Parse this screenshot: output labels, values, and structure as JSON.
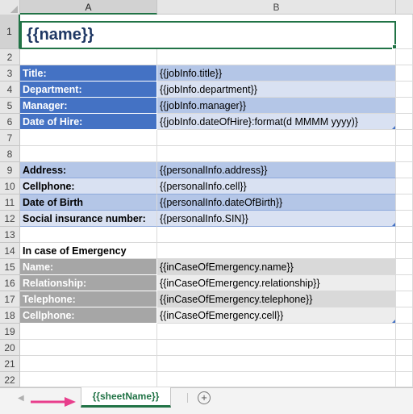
{
  "columns": [
    "A",
    "B"
  ],
  "rows": [
    "1",
    "2",
    "3",
    "4",
    "5",
    "6",
    "7",
    "8",
    "9",
    "10",
    "11",
    "12",
    "13",
    "14",
    "15",
    "16",
    "17",
    "18",
    "19",
    "20",
    "21",
    "22"
  ],
  "title": "{{name}}",
  "job_section": [
    {
      "label": "Title:",
      "value": "{{jobInfo.title}}"
    },
    {
      "label": "Department:",
      "value": "{{jobInfo.department}}"
    },
    {
      "label": "Manager:",
      "value": "{{jobInfo.manager}}"
    },
    {
      "label": "Date of Hire:",
      "value": "{{jobInfo.dateOfHire}:format(d MMMM yyyy)}"
    }
  ],
  "personal_section": [
    {
      "label": "Address:",
      "value": "{{personalInfo.address}}"
    },
    {
      "label": "Cellphone:",
      "value": "{{personalInfo.cell}}"
    },
    {
      "label": "Date of Birth",
      "value": "{{personalInfo.dateOfBirth}}"
    },
    {
      "label": "Social insurance number:",
      "value": "{{personalInfo.SIN}}"
    }
  ],
  "emergency_heading": "In case of Emergency",
  "emergency_section": [
    {
      "label": "Name:",
      "value": "{{inCaseOfEmergency.name}}"
    },
    {
      "label": "Relationship:",
      "value": "{{inCaseOfEmergency.relationship}}"
    },
    {
      "label": "Telephone:",
      "value": "{{inCaseOfEmergency.telephone}}"
    },
    {
      "label": "Cellphone:",
      "value": "{{inCaseOfEmergency.cell}}"
    }
  ],
  "sheet_tab": "{{sheetName}}",
  "add_sheet_symbol": "+",
  "colors": {
    "job_header": "#4472c4",
    "job_band_dark": "#b4c6e7",
    "job_band_light": "#d9e1f2",
    "emergency_header": "#a6a6a6",
    "title_text": "#1f3864",
    "accent_green": "#217346",
    "arrow_pink": "#e83e8c"
  }
}
